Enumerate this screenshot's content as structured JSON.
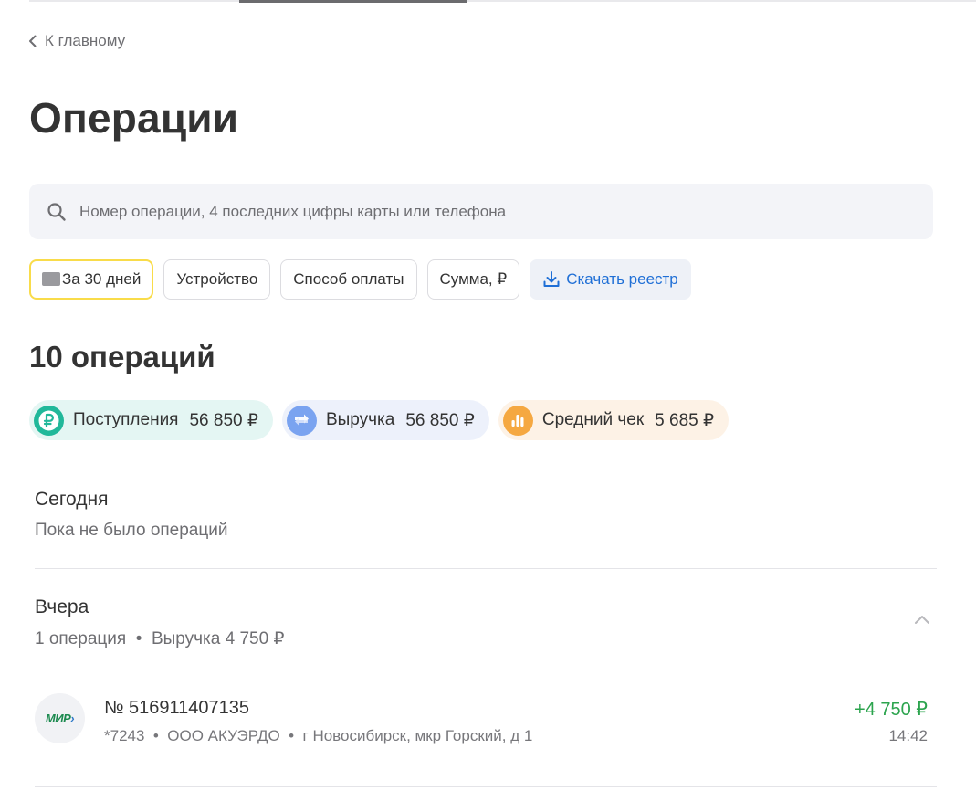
{
  "nav": {
    "back_label": "К главному"
  },
  "page": {
    "title": "Операции"
  },
  "search": {
    "placeholder": "Номер операции, 4 последних цифры карты или телефона"
  },
  "filters": {
    "period": "За 30 дней",
    "device": "Устройство",
    "payment_method": "Способ оплаты",
    "amount": "Сумма, ₽",
    "download": "Скачать реестр"
  },
  "summary": {
    "count_title": "10 операций",
    "income": {
      "label": "Поступления",
      "value": "56 850 ₽"
    },
    "revenue": {
      "label": "Выручка",
      "value": "56 850 ₽"
    },
    "average": {
      "label": "Средний чек",
      "value": "5 685 ₽"
    }
  },
  "groups": [
    {
      "title": "Сегодня",
      "subtitle": "Пока не было операций"
    },
    {
      "title": "Вчера",
      "subtitle": "1 операция  •  Выручка 4 750 ₽",
      "operations": [
        {
          "card_brand": "МИР",
          "number": "№ 516911407135",
          "details": "*7243  •  ООО АКУЭРДО  •  г Новосибирск, мкр Горский, д 1",
          "amount": "+4 750 ₽",
          "time": "14:42"
        }
      ]
    }
  ],
  "colors": {
    "accent_yellow": "#f9dc4a",
    "link_blue": "#1f6fd6",
    "income_green": "#21b89a",
    "amount_green": "#2ca44e",
    "revenue_blue": "#7aa3f0",
    "average_orange": "#f5a841"
  },
  "icons": {
    "back": "chevron-left-icon",
    "search": "search-icon",
    "period": "calendar-icon",
    "download": "download-icon",
    "income": "ruble-icon",
    "revenue": "transfer-arrows-icon",
    "average": "bar-chart-icon",
    "collapse": "chevron-up-icon"
  }
}
